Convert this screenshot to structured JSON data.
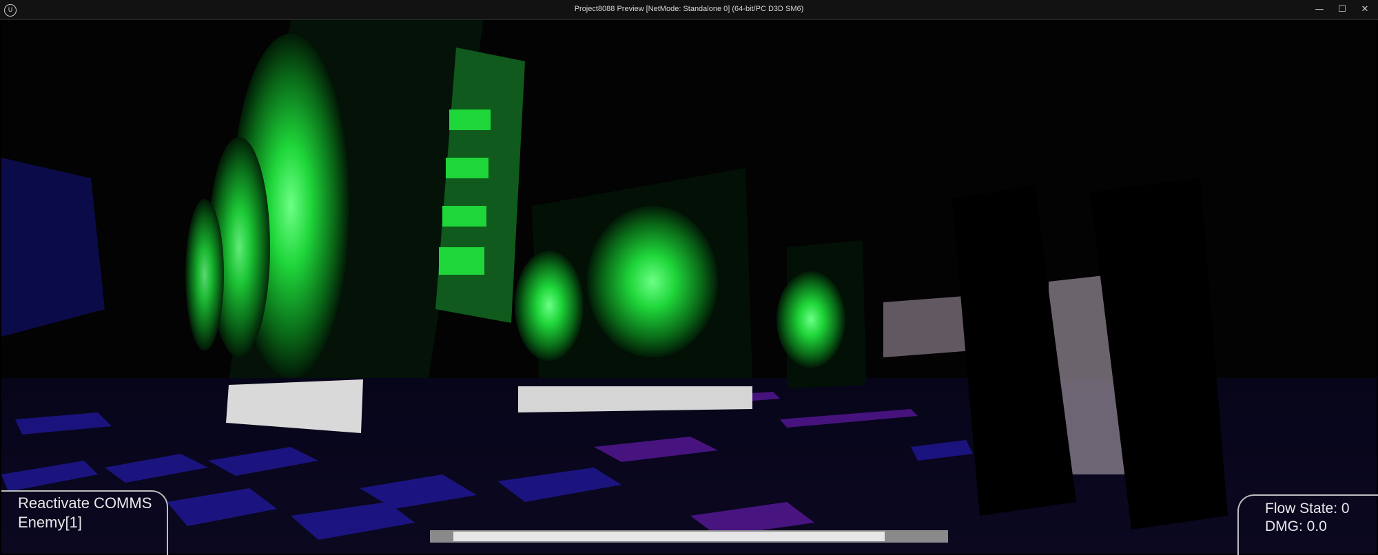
{
  "window": {
    "title": "Project8088 Preview [NetMode: Standalone 0]  (64-bit/PC D3D SM6)",
    "logo_text": "U",
    "minimize_glyph": "—",
    "maximize_glyph": "☐",
    "close_glyph": "✕"
  },
  "hud": {
    "objective_title": "Reactivate COMMS",
    "objective_detail": "Enemy[1]",
    "flow_state": "Flow State: 0",
    "damage": "DMG: 0.0",
    "progress_fraction": 0.915
  },
  "colors": {
    "fan_glow": "#1fd63a",
    "floor_blue": "#2a1fd0",
    "floor_purple": "#7a1fd0",
    "hud_text": "#e8e8e8",
    "hud_border": "#bdbdbd"
  }
}
